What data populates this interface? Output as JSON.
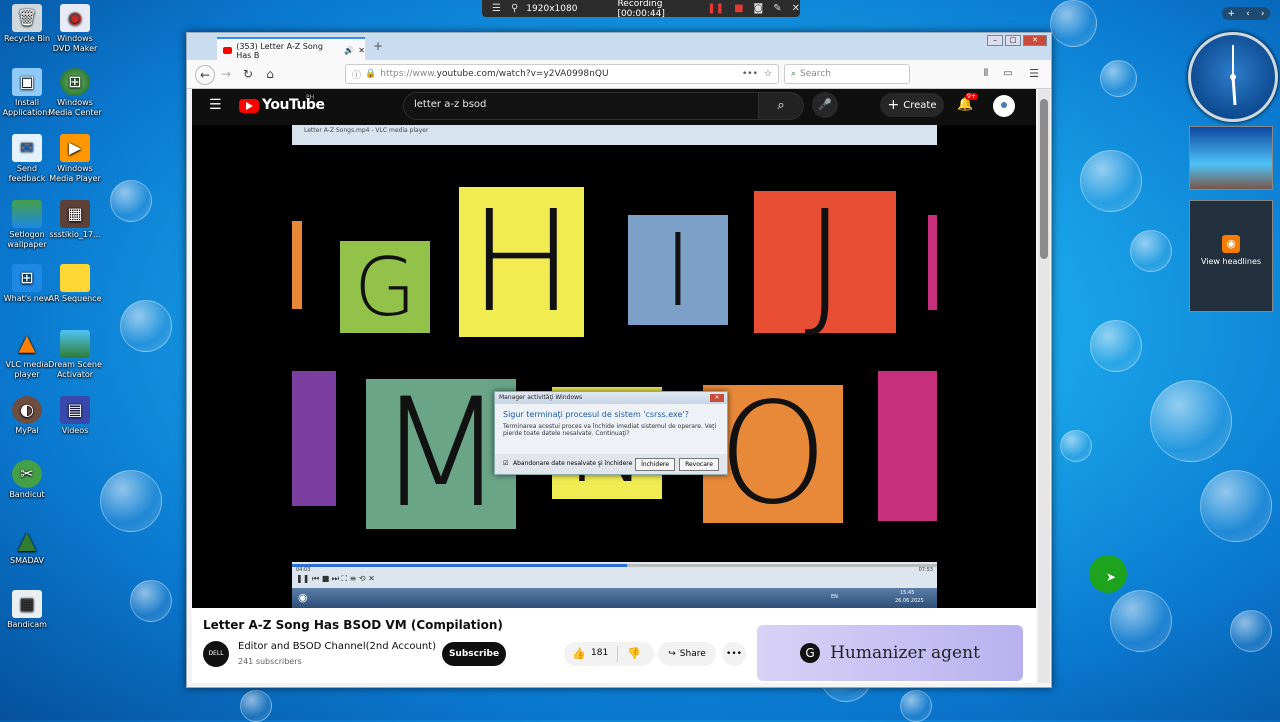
{
  "recording": {
    "resolution": "1920x1080",
    "status": "Recording [00:00:44]"
  },
  "desktop_icons": [
    {
      "label": "Recycle Bin",
      "icon": "recycle-bin-icon"
    },
    {
      "label": "Windows DVD Maker",
      "icon": "dvd-maker-icon"
    },
    {
      "label": "Install Applications",
      "icon": "install-icon"
    },
    {
      "label": "Windows Media Center",
      "icon": "media-center-icon"
    },
    {
      "label": "Send feedback",
      "icon": "feedback-icon"
    },
    {
      "label": "Windows Media Player",
      "icon": "media-player-icon"
    },
    {
      "label": "Setlogon wallpaper",
      "icon": "wallpaper-icon"
    },
    {
      "label": "ssstikio_17...",
      "icon": "video-file-icon"
    },
    {
      "label": "What's new",
      "icon": "whats-new-icon"
    },
    {
      "label": "AR Sequence",
      "icon": "folder-icon"
    },
    {
      "label": "VLC media player",
      "icon": "vlc-icon"
    },
    {
      "label": "Dream Scene Activator",
      "icon": "dream-scene-icon"
    },
    {
      "label": "MyPal",
      "icon": "mypal-icon"
    },
    {
      "label": "Videos",
      "icon": "videos-icon"
    },
    {
      "label": "Bandicut",
      "icon": "bandicut-icon"
    },
    {
      "label": "SMADAV",
      "icon": "smadav-icon"
    },
    {
      "label": "Bandicam",
      "icon": "bandicam-icon"
    }
  ],
  "gadgets": {
    "headlines": "View headlines"
  },
  "browser": {
    "tab_title": "(353) Letter A-Z Song Has B",
    "url_prefix": "https://www.",
    "url_rest": "youtube.com/watch?v=y2VA0998nQU",
    "search_placeholder": "Search"
  },
  "youtube": {
    "logo": "YouTube",
    "region": "PH",
    "search_query": "letter a-z bsod",
    "create": "Create",
    "notif_count": "9+",
    "video_title": "Letter A-Z Song Has BSOD VM (Compilation)",
    "channel_name": "Editor and BSOD Channel(2nd Account)",
    "subscribers": "241 subscribers",
    "subscribe": "Subscribe",
    "likes": "181",
    "share": "Share",
    "ad_text": "Humanizer agent"
  },
  "video_frame": {
    "vlc_title": "Letter A-Z Songs.mp4 - VLC media player",
    "vlc_time_start": "04:03",
    "vlc_time_end": "07:53",
    "letters": [
      "G",
      "H",
      "I",
      "J",
      "M",
      "N",
      "O"
    ],
    "dialog": {
      "title": "Manager activităţi Windows",
      "question": "Sigur terminaţi procesul de sistem 'csrss.exe'?",
      "message": "Terminarea acestui proces va închide imediat sistemul de operare. Veţi pierde toate datele nesalvate. Continuaţi?",
      "checkbox": "Abandonare date nesalvate şi închidere",
      "ok": "Închidere",
      "cancel": "Revocare"
    },
    "taskbar_lang": "EN",
    "taskbar_time": "15:45",
    "taskbar_date": "26.06.2025"
  }
}
